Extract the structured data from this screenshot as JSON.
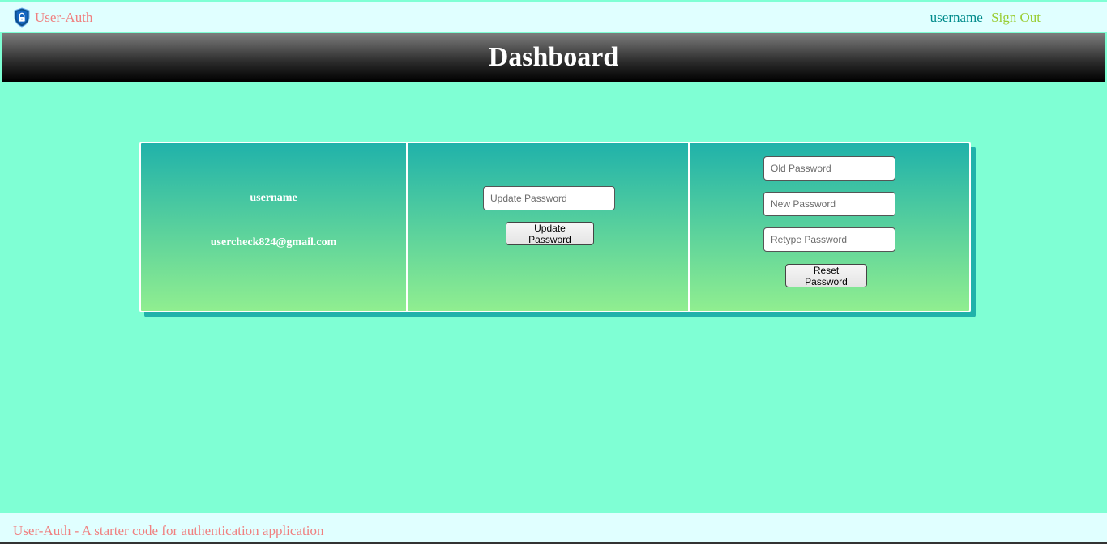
{
  "navbar": {
    "brand": "User-Auth",
    "brand_icon": "lock-shield-icon",
    "username": "username",
    "signout": "Sign Out"
  },
  "header": {
    "title": "Dashboard"
  },
  "profile": {
    "username": "username",
    "email": "usercheck824@gmail.com"
  },
  "update_form": {
    "placeholder": "Update Password",
    "button": "Update Password"
  },
  "reset_form": {
    "old_placeholder": "Old Password",
    "new_placeholder": "New Password",
    "retype_placeholder": "Retype Password",
    "button": "Reset Password"
  },
  "footer": {
    "text": "User-Auth - A starter code for authentication application"
  },
  "colors": {
    "background": "#7fffd4",
    "navbar_bg": "#e0ffff",
    "brand": "#f08080",
    "nav_user": "#008b8b",
    "signout": "#9acd32",
    "card_top": "#20b2aa",
    "card_bottom": "#90ee90"
  }
}
